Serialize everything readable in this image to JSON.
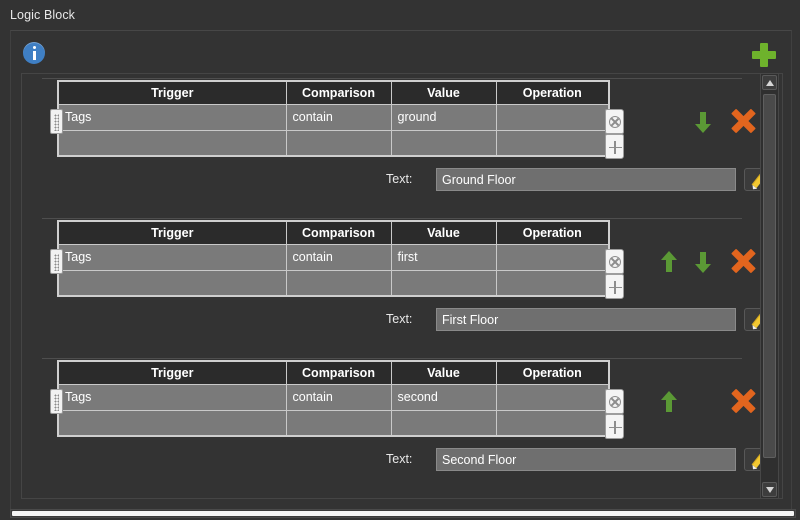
{
  "window": {
    "title": "Logic Block"
  },
  "toolbar": {
    "info_icon": "info-icon",
    "add_block_icon": "plus-icon"
  },
  "table": {
    "columns": [
      "Trigger",
      "Comparison",
      "Value",
      "Operation"
    ],
    "row_remove_icon": "circle-x-icon",
    "row_add_icon": "plus-icon",
    "drag_handle_icon": "drag-handle-icon"
  },
  "controls": {
    "move_up_icon": "arrow-up-icon",
    "move_down_icon": "arrow-down-icon",
    "delete_icon": "x-icon",
    "edit_icon": "pencil-icon",
    "text_label": "Text:"
  },
  "blocks": [
    {
      "condition": {
        "trigger": "Tags",
        "comparison": "contain",
        "value": "ground",
        "operation": ""
      },
      "text_value": "Ground Floor",
      "has_move_up": false,
      "has_move_down": true
    },
    {
      "condition": {
        "trigger": "Tags",
        "comparison": "contain",
        "value": "first",
        "operation": ""
      },
      "text_value": "First Floor",
      "has_move_up": true,
      "has_move_down": true
    },
    {
      "condition": {
        "trigger": "Tags",
        "comparison": "contain",
        "value": "second",
        "operation": ""
      },
      "text_value": "Second Floor",
      "has_move_up": true,
      "has_move_down": false
    }
  ],
  "scrollbars": {
    "vertical_up_icon": "triangle-up-icon",
    "vertical_down_icon": "triangle-down-icon"
  }
}
